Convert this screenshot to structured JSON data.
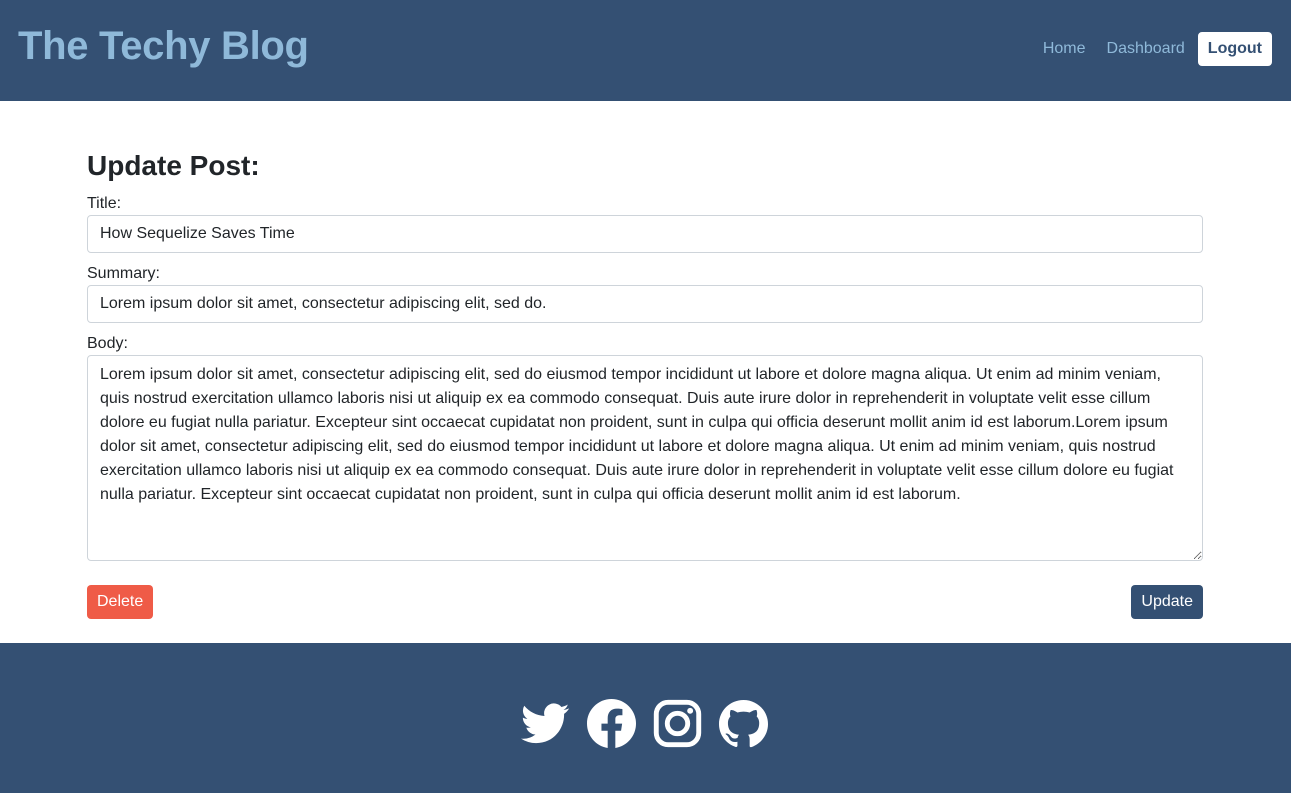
{
  "header": {
    "brand": "The Techy Blog",
    "nav": {
      "home": "Home",
      "dashboard": "Dashboard",
      "logout": "Logout"
    }
  },
  "form": {
    "heading": "Update Post:",
    "title_label": "Title:",
    "title_value": "How Sequelize Saves Time",
    "summary_label": "Summary:",
    "summary_value": "Lorem ipsum dolor sit amet, consectetur adipiscing elit, sed do.",
    "body_label": "Body:",
    "body_value": "Lorem ipsum dolor sit amet, consectetur adipiscing elit, sed do eiusmod tempor incididunt ut labore et dolore magna aliqua. Ut enim ad minim veniam, quis nostrud exercitation ullamco laboris nisi ut aliquip ex ea commodo consequat. Duis aute irure dolor in reprehenderit in voluptate velit esse cillum dolore eu fugiat nulla pariatur. Excepteur sint occaecat cupidatat non proident, sunt in culpa qui officia deserunt mollit anim id est laborum.Lorem ipsum dolor sit amet, consectetur adipiscing elit, sed do eiusmod tempor incididunt ut labore et dolore magna aliqua. Ut enim ad minim veniam, quis nostrud exercitation ullamco laboris nisi ut aliquip ex ea commodo consequat. Duis aute irure dolor in reprehenderit in voluptate velit esse cillum dolore eu fugiat nulla pariatur. Excepteur sint occaecat cupidatat non proident, sunt in culpa qui officia deserunt mollit anim id est laborum.",
    "delete_label": "Delete",
    "update_label": "Update"
  },
  "footer": {
    "social_icons": [
      "twitter-icon",
      "facebook-icon",
      "instagram-icon",
      "github-icon"
    ]
  },
  "colors": {
    "navy": "#345073",
    "brand_text": "#8fb9d9",
    "delete": "#ef5b47"
  }
}
